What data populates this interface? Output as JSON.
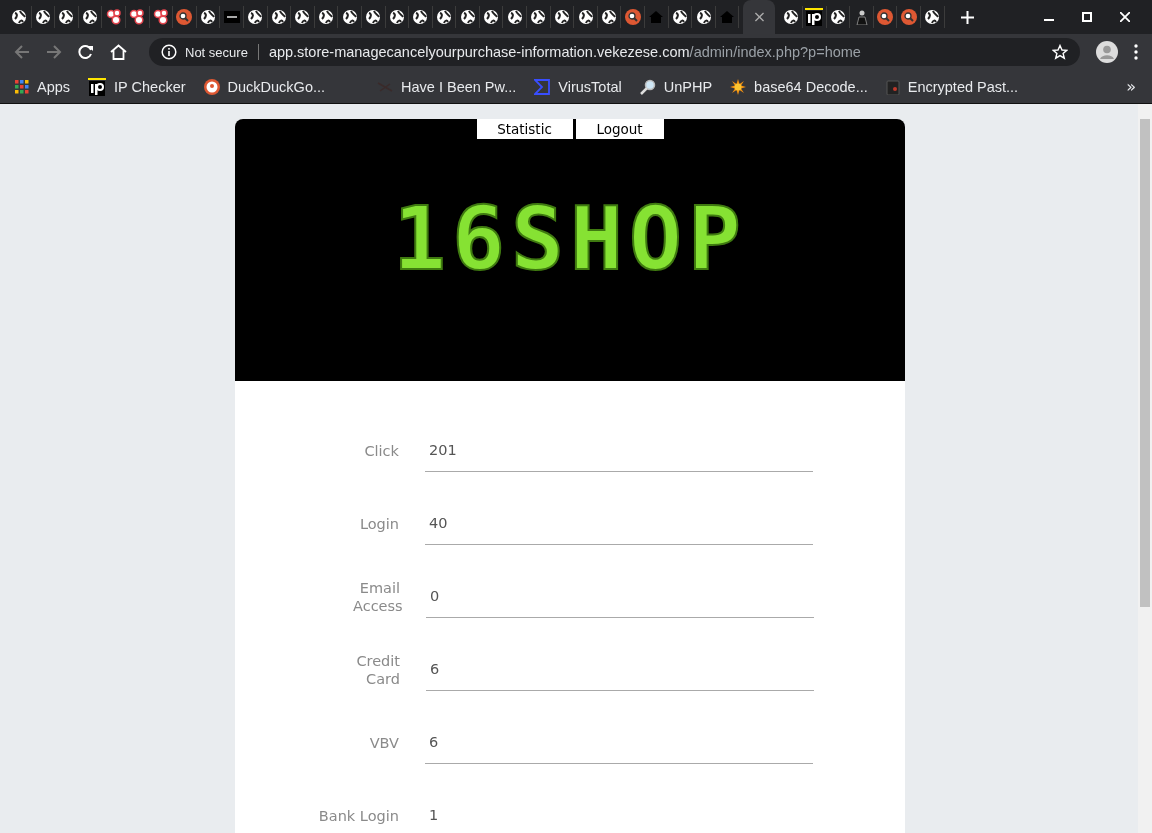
{
  "tabs": [
    {
      "kind": "globe",
      "selected": false
    },
    {
      "kind": "globe",
      "selected": false
    },
    {
      "kind": "globe",
      "selected": false
    },
    {
      "kind": "globe",
      "selected": false
    },
    {
      "kind": "bubbles",
      "selected": false
    },
    {
      "kind": "bubbles",
      "selected": false
    },
    {
      "kind": "bubbles",
      "selected": false
    },
    {
      "kind": "search",
      "selected": false
    },
    {
      "kind": "globe",
      "selected": false
    },
    {
      "kind": "dark",
      "selected": false
    },
    {
      "kind": "globe",
      "selected": false
    },
    {
      "kind": "globe",
      "selected": false
    },
    {
      "kind": "globe",
      "selected": false
    },
    {
      "kind": "globe",
      "selected": false
    },
    {
      "kind": "globe",
      "selected": false
    },
    {
      "kind": "globe",
      "selected": false
    },
    {
      "kind": "globe",
      "selected": false
    },
    {
      "kind": "globe",
      "selected": false
    },
    {
      "kind": "globe",
      "selected": false
    },
    {
      "kind": "globe",
      "selected": false
    },
    {
      "kind": "globe",
      "selected": false
    },
    {
      "kind": "globe",
      "selected": false
    },
    {
      "kind": "globe",
      "selected": false
    },
    {
      "kind": "globe",
      "selected": false
    },
    {
      "kind": "globe",
      "selected": false
    },
    {
      "kind": "globe",
      "selected": false
    },
    {
      "kind": "search",
      "selected": false
    },
    {
      "kind": "home",
      "selected": false
    },
    {
      "kind": "globe",
      "selected": false
    },
    {
      "kind": "globe",
      "selected": false
    },
    {
      "kind": "home",
      "selected": false
    },
    {
      "kind": "none",
      "selected": true,
      "close": "×"
    },
    {
      "kind": "globe",
      "selected": false
    },
    {
      "kind": "ip",
      "selected": false
    },
    {
      "kind": "globe",
      "selected": false
    },
    {
      "kind": "person",
      "selected": false
    },
    {
      "kind": "search",
      "selected": false
    },
    {
      "kind": "search",
      "selected": false
    },
    {
      "kind": "globe",
      "selected": false
    }
  ],
  "address_bar": {
    "security": "Not secure",
    "host": "app.store-managecancelyourpurchase-information.vekezese.com",
    "path": "/admin/index.php?p=home"
  },
  "bookmarks": [
    {
      "kind": "apps",
      "label": "Apps"
    },
    {
      "kind": "ip",
      "label": "IP Checker"
    },
    {
      "kind": "duck",
      "label": "DuckDuckGo..."
    },
    {
      "kind": "blank",
      "label": "Have I Been Pw..."
    },
    {
      "kind": "sigma",
      "label": "VirusTotal"
    },
    {
      "kind": "magnifier",
      "label": "UnPHP"
    },
    {
      "kind": "sun",
      "label": "base64 Decode..."
    },
    {
      "kind": "clipboard",
      "label": "Encrypted Past..."
    }
  ],
  "bookmarks_more": "»",
  "nav": [
    {
      "label": "Statistic"
    },
    {
      "label": "Logout"
    }
  ],
  "logo": "16SHOP",
  "stats": [
    {
      "label": "Click",
      "value": "201"
    },
    {
      "label": "Login",
      "value": "40"
    },
    {
      "label": "Email Access",
      "value": "0"
    },
    {
      "label": "Credit Card",
      "value": "6"
    },
    {
      "label": "VBV",
      "value": "6"
    },
    {
      "label": "Bank Login",
      "value": "1"
    }
  ]
}
